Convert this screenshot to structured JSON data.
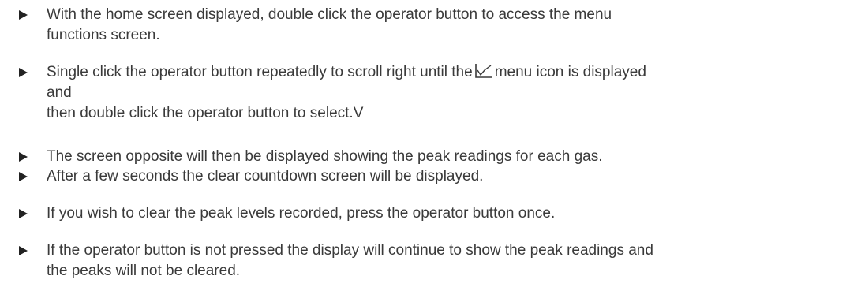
{
  "steps": [
    {
      "lines": [
        "With the home screen displayed, double click the operator button to access the menu",
        "functions screen."
      ]
    },
    {
      "line1_before_icon": "Single click the operator button repeatedly to scroll right until the",
      "icon": "peak-graph-icon",
      "line1_after_icon": "menu icon is displayed",
      "lines_rest": [
        "and",
        "then double click the operator button to select.V"
      ]
    },
    {
      "lines": [
        "The screen opposite will then be displayed showing the peak readings for each gas."
      ]
    },
    {
      "lines": [
        "After a few seconds the clear countdown screen will be displayed."
      ]
    },
    {
      "lines": [
        "If you wish to clear the peak levels recorded, press the operator button once."
      ]
    },
    {
      "lines": [
        "If the operator button is not pressed the display will continue to show the peak readings and",
        "the peaks will not be cleared."
      ]
    }
  ],
  "bullet_icon": "right-triangle-bullet-icon"
}
